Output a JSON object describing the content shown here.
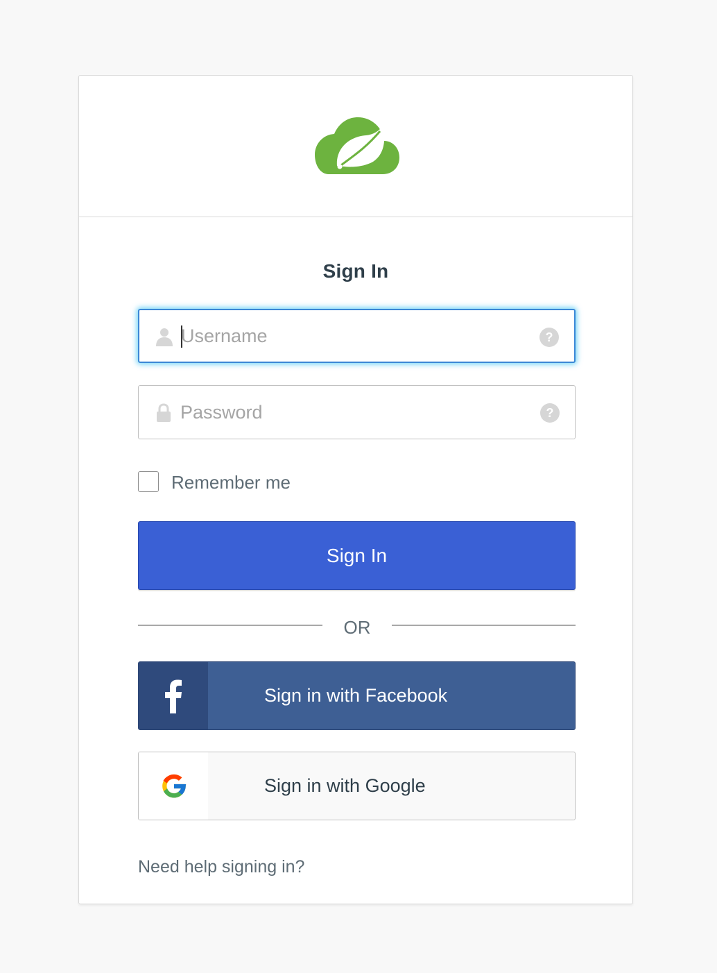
{
  "brand": {
    "logo_icon": "spring-cloud-leaf-icon",
    "logo_color": "#6db33f"
  },
  "form": {
    "title": "Sign In",
    "username": {
      "placeholder": "Username",
      "value": "",
      "lead_icon": "user-icon",
      "help_icon": "question-icon",
      "help_text": "?"
    },
    "password": {
      "placeholder": "Password",
      "value": "",
      "lead_icon": "lock-icon",
      "help_icon": "question-icon",
      "help_text": "?"
    },
    "remember_me": {
      "label": "Remember me",
      "checked": false
    },
    "submit_label": "Sign In",
    "submit_color": "#3a60d5"
  },
  "divider": {
    "text": "OR"
  },
  "social": {
    "facebook": {
      "label": "Sign in with Facebook",
      "icon": "facebook-icon",
      "color": "#3e5f94"
    },
    "google": {
      "label": "Sign in with Google",
      "icon": "google-icon"
    }
  },
  "help_link": "Need help signing in?"
}
